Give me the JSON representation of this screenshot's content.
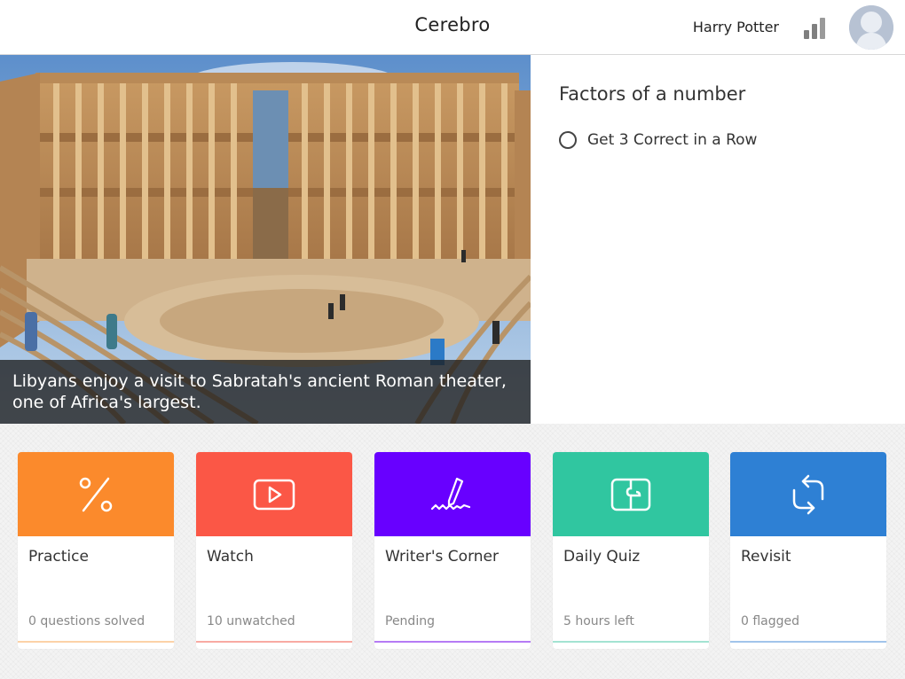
{
  "header": {
    "title": "Cerebro",
    "user_name": "Harry Potter",
    "stats_icon": "bar-chart-icon",
    "avatar_icon": "user-avatar"
  },
  "hero": {
    "caption": "Libyans enjoy a visit to Sabratah's ancient Roman theater, one of Africa's largest."
  },
  "panel": {
    "title": "Factors of a number",
    "goal_label": "Get 3 Correct in a Row"
  },
  "cards": [
    {
      "title": "Practice",
      "subtitle": "0 questions solved",
      "color": "#fb8a2c",
      "line": "#fcd2a7",
      "icon": "percent-icon"
    },
    {
      "title": "Watch",
      "subtitle": "10 unwatched",
      "color": "#fb5746",
      "line": "#f8aaa2",
      "icon": "play-icon"
    },
    {
      "title": "Writer's Corner",
      "subtitle": "Pending",
      "color": "#6800ff",
      "line": "#b57bf5",
      "icon": "pen-icon"
    },
    {
      "title": "Daily Quiz",
      "subtitle": "5 hours left",
      "color": "#30c6a0",
      "line": "#a3e3d2",
      "icon": "puzzle-icon"
    },
    {
      "title": "Revisit",
      "subtitle": "0 flagged",
      "color": "#2e80d4",
      "line": "#a1c4ea",
      "icon": "refresh-icon"
    }
  ]
}
